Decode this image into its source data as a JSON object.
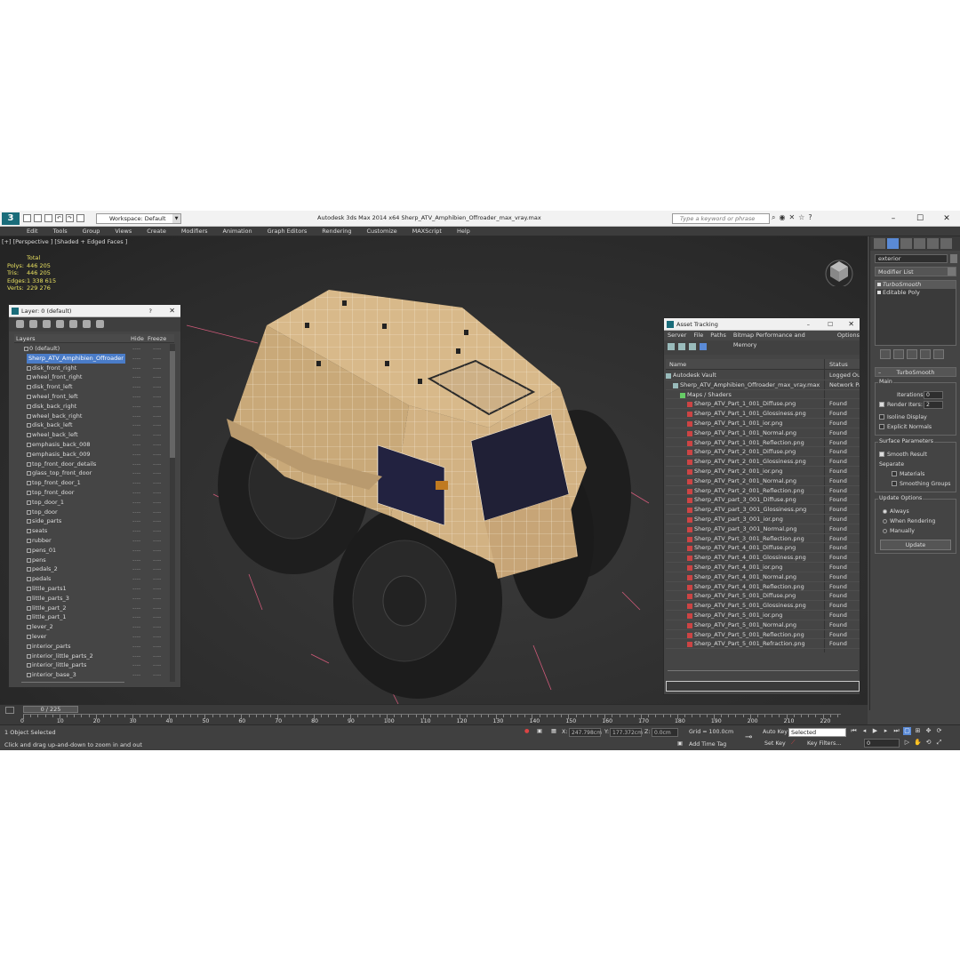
{
  "app": {
    "window_title": "Autodesk 3ds Max  2014 x64      Sherp_ATV_Amphibien_Offroader_max_vray.max",
    "workspace": "Workspace: Default",
    "search_placeholder": "Type a keyword or phrase",
    "menu": [
      "Edit",
      "Tools",
      "Group",
      "Views",
      "Create",
      "Modifiers",
      "Animation",
      "Graph Editors",
      "Rendering",
      "Customize",
      "MAXScript",
      "Help"
    ]
  },
  "viewport": {
    "label": "[+] [Perspective ] [Shaded + Edged Faces ]",
    "stats": {
      "total_label": "Total",
      "rows": [
        {
          "k": "Polys:",
          "v": "446 205"
        },
        {
          "k": "Tris:",
          "v": "446 205"
        },
        {
          "k": "Edges:",
          "v": "1 338 615"
        },
        {
          "k": "Verts:",
          "v": "229 276"
        }
      ]
    }
  },
  "layer_dialog": {
    "title": "Layer: 0 (default)",
    "help": "?",
    "columns": {
      "layers": "Layers",
      "hide": "Hide",
      "freeze": "Freeze"
    },
    "rows": [
      {
        "name": "0 (default)",
        "level": 0
      },
      {
        "name": "Sherp_ATV_Amphibien_Offroader",
        "level": 0,
        "selected": true
      },
      {
        "name": "disk_front_right",
        "level": 1
      },
      {
        "name": "wheel_front_right",
        "level": 1
      },
      {
        "name": "disk_front_left",
        "level": 1
      },
      {
        "name": "wheel_front_left",
        "level": 1
      },
      {
        "name": "disk_back_right",
        "level": 1
      },
      {
        "name": "wheel_back_right",
        "level": 1
      },
      {
        "name": "disk_back_left",
        "level": 1
      },
      {
        "name": "wheel_back_left",
        "level": 1
      },
      {
        "name": "emphasis_back_008",
        "level": 1
      },
      {
        "name": "emphasis_back_009",
        "level": 1
      },
      {
        "name": "top_front_door_details",
        "level": 1
      },
      {
        "name": "glass_top_front_door",
        "level": 1
      },
      {
        "name": "top_front_door_1",
        "level": 1
      },
      {
        "name": "top_front_door",
        "level": 1
      },
      {
        "name": "top_door_1",
        "level": 1
      },
      {
        "name": "top_door",
        "level": 1
      },
      {
        "name": "side_parts",
        "level": 1
      },
      {
        "name": "seats",
        "level": 1
      },
      {
        "name": "rubber",
        "level": 1
      },
      {
        "name": "pens_01",
        "level": 1
      },
      {
        "name": "pens",
        "level": 1
      },
      {
        "name": "pedals_2",
        "level": 1
      },
      {
        "name": "pedals",
        "level": 1
      },
      {
        "name": "little_parts1",
        "level": 1
      },
      {
        "name": "little_parts_3",
        "level": 1
      },
      {
        "name": "little_part_2",
        "level": 1
      },
      {
        "name": "little_part_1",
        "level": 1
      },
      {
        "name": "lever_2",
        "level": 1
      },
      {
        "name": "lever",
        "level": 1
      },
      {
        "name": "interior_parts",
        "level": 1
      },
      {
        "name": "interior_little_parts_2",
        "level": 1
      },
      {
        "name": "interior_little_parts",
        "level": 1
      },
      {
        "name": "interior_base_3",
        "level": 1
      }
    ]
  },
  "asset_dialog": {
    "title": "Asset Tracking",
    "menu": [
      "Server",
      "File",
      "Paths",
      "Bitmap Performance and Memory",
      "Options"
    ],
    "columns": {
      "name": "Name",
      "status": "Status"
    },
    "rows": [
      {
        "name": "Autodesk Vault",
        "status": "Logged Ou",
        "indent": 1
      },
      {
        "name": "Sherp_ATV_Amphibien_Offroader_max_vray.max",
        "status": "Network Pa",
        "indent": 2
      },
      {
        "name": "Maps / Shaders",
        "status": "",
        "indent": 3
      },
      {
        "name": "Sherp_ATV_Part_1_001_Diffuse.png",
        "status": "Found",
        "indent": 4
      },
      {
        "name": "Sherp_ATV_Part_1_001_Glossiness.png",
        "status": "Found",
        "indent": 4
      },
      {
        "name": "Sherp_ATV_Part_1_001_ior.png",
        "status": "Found",
        "indent": 4
      },
      {
        "name": "Sherp_ATV_Part_1_001_Normal.png",
        "status": "Found",
        "indent": 4
      },
      {
        "name": "Sherp_ATV_Part_1_001_Reflection.png",
        "status": "Found",
        "indent": 4
      },
      {
        "name": "Sherp_ATV_Part_2_001_Diffuse.png",
        "status": "Found",
        "indent": 4
      },
      {
        "name": "Sherp_ATV_Part_2_001_Glossiness.png",
        "status": "Found",
        "indent": 4
      },
      {
        "name": "Sherp_ATV_Part_2_001_ior.png",
        "status": "Found",
        "indent": 4
      },
      {
        "name": "Sherp_ATV_Part_2_001_Normal.png",
        "status": "Found",
        "indent": 4
      },
      {
        "name": "Sherp_ATV_Part_2_001_Reflection.png",
        "status": "Found",
        "indent": 4
      },
      {
        "name": "Sherp_ATV_part_3_001_Diffuse.png",
        "status": "Found",
        "indent": 4
      },
      {
        "name": "Sherp_ATV_part_3_001_Glossiness.png",
        "status": "Found",
        "indent": 4
      },
      {
        "name": "Sherp_ATV_part_3_001_ior.png",
        "status": "Found",
        "indent": 4
      },
      {
        "name": "Sherp_ATV_part_3_001_Normal.png",
        "status": "Found",
        "indent": 4
      },
      {
        "name": "Sherp_ATV_Part_3_001_Reflection.png",
        "status": "Found",
        "indent": 4
      },
      {
        "name": "Sherp_ATV_Part_4_001_Diffuse.png",
        "status": "Found",
        "indent": 4
      },
      {
        "name": "Sherp_ATV_Part_4_001_Glossiness.png",
        "status": "Found",
        "indent": 4
      },
      {
        "name": "Sherp_ATV_Part_4_001_ior.png",
        "status": "Found",
        "indent": 4
      },
      {
        "name": "Sherp_ATV_Part_4_001_Normal.png",
        "status": "Found",
        "indent": 4
      },
      {
        "name": "Sherp_ATV_Part_4_001_Reflection.png",
        "status": "Found",
        "indent": 4
      },
      {
        "name": "Sherp_ATV_Part_5_001_Diffuse.png",
        "status": "Found",
        "indent": 4
      },
      {
        "name": "Sherp_ATV_Part_5_001_Glossiness.png",
        "status": "Found",
        "indent": 4
      },
      {
        "name": "Sherp_ATV_Part_5_001_ior.png",
        "status": "Found",
        "indent": 4
      },
      {
        "name": "Sherp_ATV_Part_5_001_Normal.png",
        "status": "Found",
        "indent": 4
      },
      {
        "name": "Sherp_ATV_Part_5_001_Reflection.png",
        "status": "Found",
        "indent": 4
      },
      {
        "name": "Sherp_ATV_Part_5_001_Refraction.png",
        "status": "Found",
        "indent": 4
      },
      {
        "name": "",
        "status": "",
        "indent": 0
      },
      {
        "name": "",
        "status": "",
        "indent": 0
      }
    ]
  },
  "command_panel": {
    "object_name": "exterior",
    "modifier_list": "Modifier List",
    "stack": [
      "TurboSmooth",
      "Editable Poly"
    ],
    "rollout_title": "TurboSmooth",
    "main_label": "Main",
    "iterations_label": "Iterations:",
    "iterations_value": "0",
    "render_iters_label": "Render Iters:",
    "render_iters_value": "2",
    "isoline": "Isoline Display",
    "explicit": "Explicit Normals",
    "surface_label": "Surface Parameters",
    "smooth_result": "Smooth Result",
    "separate_label": "Separate",
    "materials": "Materials",
    "smoothing_groups": "Smoothing Groups",
    "update_label": "Update Options",
    "always": "Always",
    "when_rendering": "When Rendering",
    "manually": "Manually",
    "update_button": "Update"
  },
  "timeline": {
    "slider": "0 / 225",
    "labels": [
      "0",
      "10",
      "20",
      "30",
      "40",
      "50",
      "60",
      "70",
      "80",
      "90",
      "100",
      "110",
      "120",
      "130",
      "140",
      "150",
      "160",
      "170",
      "180",
      "190",
      "200",
      "210",
      "220"
    ]
  },
  "status": {
    "selected": "1 Object Selected",
    "hint": "Click and drag up-and-down to zoom in and out",
    "x": "247.798cm",
    "y": "177.372cm",
    "z": "0.0cm",
    "grid": "Grid = 100.0cm",
    "add_time_tag": "Add Time Tag",
    "auto_key": "Auto Key",
    "auto_key_value": "Selected",
    "set_key": "Set Key",
    "key_filters": "Key Filters...",
    "frame": "0"
  }
}
